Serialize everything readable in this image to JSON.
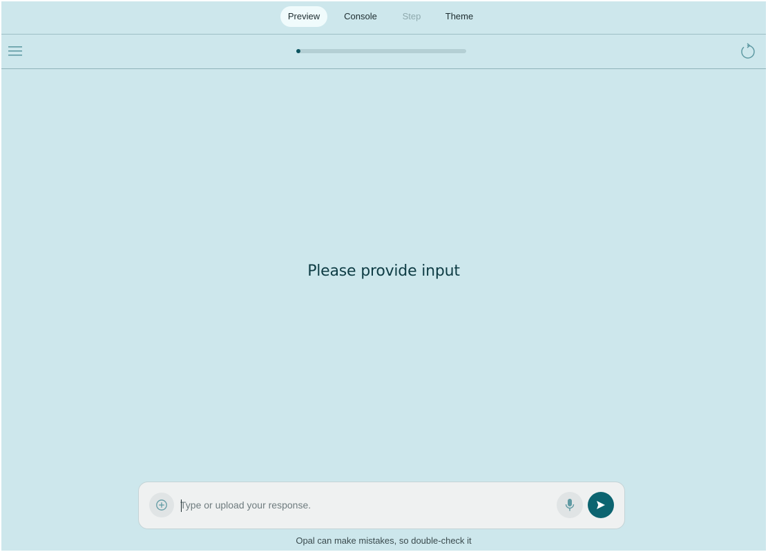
{
  "tabs": [
    {
      "label": "Preview",
      "state": "active"
    },
    {
      "label": "Console",
      "state": "normal"
    },
    {
      "label": "Step",
      "state": "disabled"
    },
    {
      "label": "Theme",
      "state": "normal"
    }
  ],
  "toolbar": {
    "menu_icon": "hamburger-menu-icon",
    "reset_icon": "restart-icon",
    "progress": 0.01
  },
  "main": {
    "prompt_title": "Please provide input"
  },
  "input_bar": {
    "placeholder": "Type or upload your response.",
    "value": "",
    "attach_icon": "add-circle-icon",
    "mic_icon": "microphone-icon",
    "send_icon": "send-icon"
  },
  "footer": {
    "disclaimer": "Opal can make mistakes, so double-check it"
  },
  "colors": {
    "background": "#cde7ec",
    "accent": "#0c6470",
    "title": "#0e3c44"
  }
}
